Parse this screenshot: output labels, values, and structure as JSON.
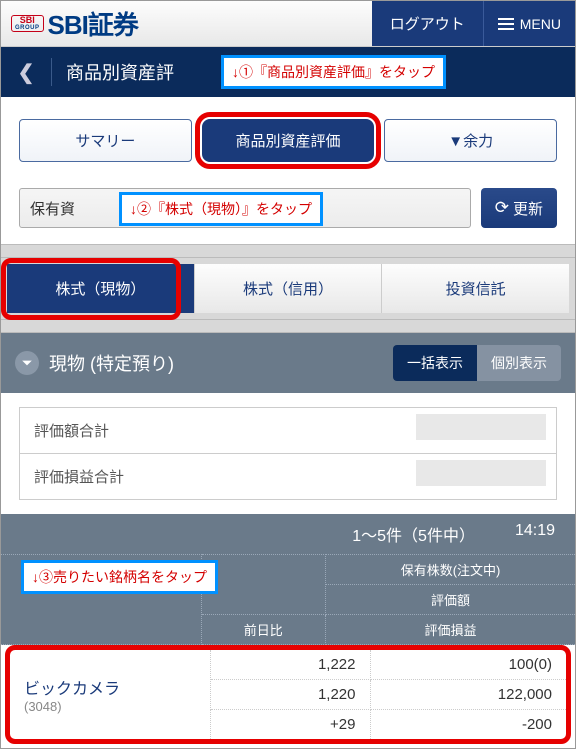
{
  "header": {
    "logo_main": "SBI",
    "logo_sub": "GROUP",
    "brand": "SBI証券",
    "logout": "ログアウト",
    "menu": "MENU"
  },
  "nav": {
    "title": "商品別資産評"
  },
  "callouts": {
    "c1": "↓①『商品別資産評価』をタップ",
    "c2": "↓②『株式（現物）』をタップ",
    "c3": "↓③売りたい銘柄名をタップ"
  },
  "tabs": {
    "summary": "サマリー",
    "assets": "商品別資産評価",
    "extra": "▼余力"
  },
  "filter": {
    "label": "保有資",
    "update": "更新"
  },
  "subtabs": {
    "spot": "株式（現物）",
    "margin": "株式（信用）",
    "fund": "投資信託"
  },
  "section": {
    "title": "現物 (特定預り)",
    "bulk": "一括表示",
    "individual": "個別表示"
  },
  "summary": {
    "valuation_label": "評価額合計",
    "pl_label": "評価損益合計"
  },
  "grid": {
    "range": "1〜5件（5件中）",
    "time": "14:19",
    "col_name": "",
    "col_prev": "前日比",
    "col_qty": "保有株数(注文中)",
    "col_val": "評価額",
    "col_pl": "評価損益"
  },
  "row1": {
    "name": "ビックカメラ",
    "code": "(3048)",
    "price": "1,222",
    "qty": "100(0)",
    "prev": "1,220",
    "valuation": "122,000",
    "change": "+29",
    "pl": "-200"
  }
}
